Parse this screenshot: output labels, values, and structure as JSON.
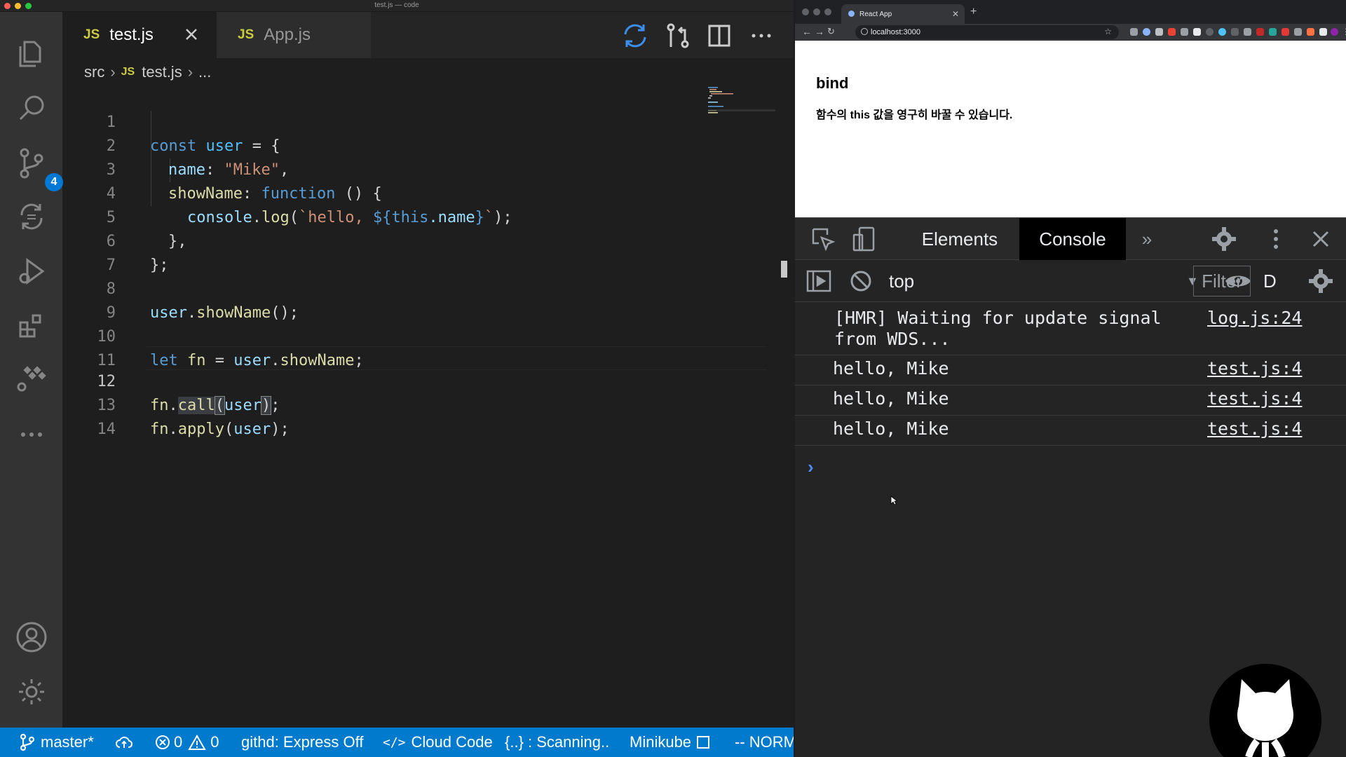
{
  "vscode": {
    "window_title": "test.js — code",
    "activity_bar": {
      "scm_badge": "4"
    },
    "tabs": [
      {
        "icon": "JS",
        "label": "test.js",
        "active": true
      },
      {
        "icon": "JS",
        "label": "App.js",
        "active": false
      }
    ],
    "breadcrumb": [
      "src",
      "JS",
      "test.js",
      "..."
    ],
    "code_lines": [
      {
        "n": "1"
      },
      {
        "n": "2"
      },
      {
        "n": "3"
      },
      {
        "n": "4"
      },
      {
        "n": "5"
      },
      {
        "n": "6"
      },
      {
        "n": "7"
      },
      {
        "n": "8"
      },
      {
        "n": "9"
      },
      {
        "n": "10"
      },
      {
        "n": "11"
      },
      {
        "n": "12"
      },
      {
        "n": "13"
      },
      {
        "n": "14"
      }
    ],
    "code_tokens": {
      "l1": [
        "const",
        "user",
        "=",
        "{"
      ],
      "l2": [
        "name",
        ":",
        "\"Mike\"",
        ","
      ],
      "l3": [
        "showName",
        ":",
        "function",
        "()",
        "{"
      ],
      "l4": [
        "console",
        ".",
        "log",
        "(",
        "`hello, ",
        "${",
        "this",
        ".name",
        "}",
        "`",
        ");"
      ],
      "l5": [
        "},"
      ],
      "l6": [
        "};"
      ],
      "l8": [
        "user",
        ".",
        "showName",
        "();"
      ],
      "l10": [
        "let",
        "fn",
        "=",
        "user",
        ".",
        "showName",
        ";"
      ],
      "l12": [
        "fn",
        ".",
        "call",
        "(",
        "user",
        ")",
        ";"
      ],
      "l13": [
        "fn",
        ".",
        "apply",
        "(",
        "user",
        ");"
      ]
    },
    "status_bar": {
      "branch": "master*",
      "errors": "0",
      "warnings": "0",
      "githd": "githd: Express Off",
      "cloud_code": "Cloud Code",
      "scanning": "{..} : Scanning..",
      "minikube": "Minikube",
      "mode": "-- NORM"
    }
  },
  "browser": {
    "tab_title": "React App",
    "url": "localhost:3000",
    "page": {
      "heading": "bind",
      "text": "함수의 this 값을 영구히 바꿀 수 있습니다."
    },
    "devtools": {
      "tabs": [
        "Elements",
        "Console"
      ],
      "active_tab": "Console",
      "context": "top",
      "filter_placeholder": "Filter",
      "levels_label": "D",
      "messages": [
        {
          "text": "[HMR] Waiting for update signal\nfrom WDS...",
          "source": "log.js:24"
        },
        {
          "text": "hello, Mike",
          "source": "test.js:4"
        },
        {
          "text": "hello, Mike",
          "source": "test.js:4"
        },
        {
          "text": "hello, Mike",
          "source": "test.js:4"
        }
      ]
    }
  },
  "colors": {
    "statusbar": "#007acc",
    "keyword": "#569cd6",
    "string": "#ce9178",
    "function": "#dcdcaa",
    "variable": "#9cdcfe",
    "js_icon": "#cbcb41"
  }
}
